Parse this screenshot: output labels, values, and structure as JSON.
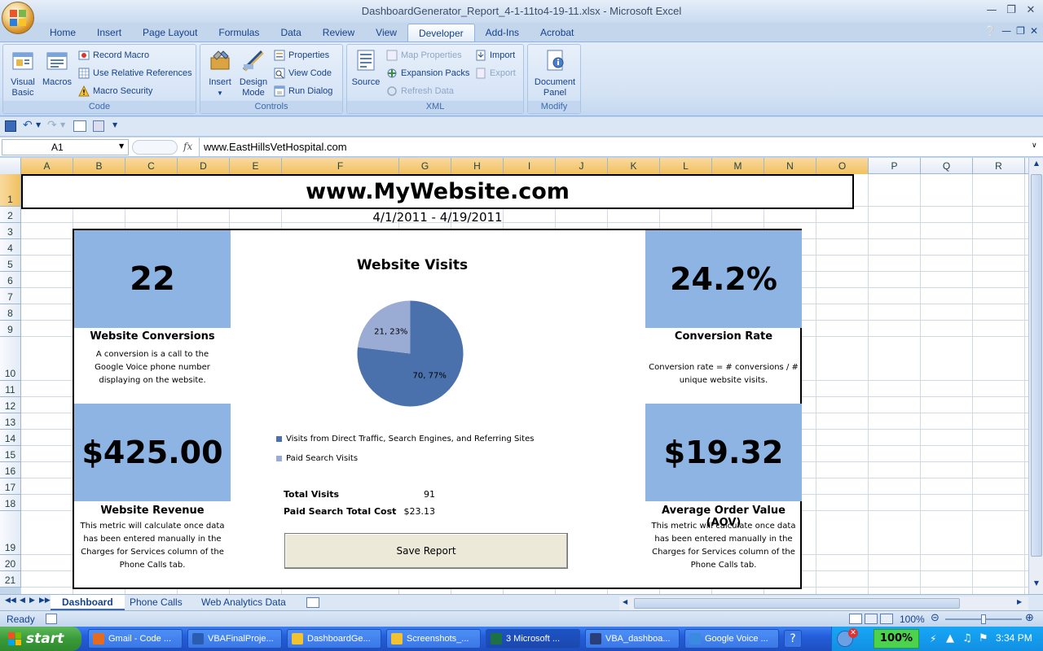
{
  "window": {
    "title": "DashboardGenerator_Report_4-1-11to4-19-11.xlsx - Microsoft Excel"
  },
  "ribbon_tabs": [
    "Home",
    "Insert",
    "Page Layout",
    "Formulas",
    "Data",
    "Review",
    "View",
    "Developer",
    "Add-Ins",
    "Acrobat"
  ],
  "active_tab": "Developer",
  "ribbon": {
    "code": {
      "label": "Code",
      "visual_basic": "Visual Basic",
      "visual_basic_l1": "Visual",
      "visual_basic_l2": "Basic",
      "macros": "Macros",
      "record_macro": "Record Macro",
      "relative_refs": "Use Relative References",
      "macro_security": "Macro Security"
    },
    "controls": {
      "label": "Controls",
      "insert": "Insert",
      "design_mode_l1": "Design",
      "design_mode_l2": "Mode",
      "properties": "Properties",
      "view_code": "View Code",
      "run_dialog": "Run Dialog"
    },
    "xml": {
      "label": "XML",
      "source": "Source",
      "map_properties": "Map Properties",
      "expansion_packs": "Expansion Packs",
      "refresh_data": "Refresh Data",
      "import": "Import",
      "export": "Export"
    },
    "modify": {
      "label": "Modify",
      "document_panel_l1": "Document",
      "document_panel_l2": "Panel"
    }
  },
  "formula_bar": {
    "name_box": "A1",
    "fx": "fx",
    "content": "www.EastHillsVetHospital.com"
  },
  "columns": [
    "A",
    "B",
    "C",
    "D",
    "E",
    "F",
    "G",
    "H",
    "I",
    "J",
    "K",
    "L",
    "M",
    "N",
    "O",
    "P",
    "Q",
    "R"
  ],
  "rows": [
    "1",
    "2",
    "3",
    "4",
    "5",
    "6",
    "7",
    "8",
    "9",
    "10",
    "11",
    "12",
    "13",
    "14",
    "15",
    "16",
    "17",
    "18",
    "19",
    "20",
    "21"
  ],
  "dashboard": {
    "site_title": "www.MyWebsite.com",
    "date_range": "4/1/2011 - 4/19/2011",
    "kpis": {
      "conversions": {
        "value": "22",
        "label": "Website Conversions",
        "desc": "A conversion is a call to the Google Voice phone number displaying on the website."
      },
      "conversion_rate": {
        "value": "24.2%",
        "label": "Conversion Rate",
        "desc": "Conversion rate = # conversions / # unique website visits."
      },
      "revenue": {
        "value": "$425.00",
        "label": "Website Revenue",
        "desc": "This metric will calculate once data has been entered manually in the Charges for Services column of the Phone Calls tab."
      },
      "aov": {
        "value": "$19.32",
        "label": "Average Order Value (AOV)",
        "desc": "This metric will calculate once data has been entered manually in the Charges for Services column of the Phone Calls tab."
      }
    },
    "stats": {
      "total_visits_label": "Total Visits",
      "total_visits_value": "91",
      "paid_cost_label": "Paid Search Total Cost",
      "paid_cost_value": "$23.13"
    },
    "save_button": "Save Report"
  },
  "chart_data": {
    "type": "pie",
    "title": "Website Visits",
    "series": [
      {
        "name": "Visits from Direct Traffic, Search Engines, and Referring Sites",
        "value": 70,
        "percent": 77,
        "label": "70, 77%",
        "color": "#4a71ac"
      },
      {
        "name": "Paid Search Visits",
        "value": 21,
        "percent": 23,
        "label": "21, 23%",
        "color": "#9aacd3"
      }
    ],
    "legend_position": "bottom"
  },
  "sheet_tabs": [
    "Dashboard",
    "Phone Calls",
    "Web Analytics Data"
  ],
  "active_sheet": "Dashboard",
  "status": {
    "text": "Ready",
    "zoom": "100%"
  },
  "taskbar": {
    "start": "start",
    "items": [
      "Gmail - Code ...",
      "VBAFinalProje...",
      "DashboardGe...",
      "Screenshots_...",
      "3 Microsoft ...",
      "VBA_dashboa...",
      "Google Voice ..."
    ],
    "active_item": "3 Microsoft ...",
    "tray_zoom": "100%",
    "clock": "3:34 PM"
  },
  "colors": {
    "kpi_tile": "#8db4e2",
    "pie_main": "#4a71ac",
    "pie_paid": "#9aacd3"
  }
}
